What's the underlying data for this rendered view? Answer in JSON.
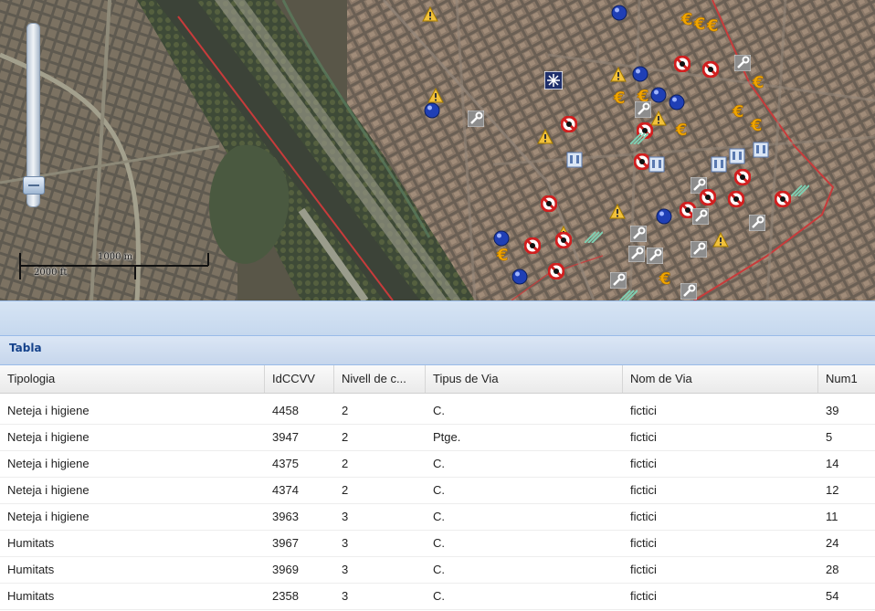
{
  "map": {
    "scale": {
      "metric_label": "1000 m",
      "imperial_label": "2000 ft"
    },
    "icons": {
      "warning": "warning-triangle-icon",
      "euro": "euro-icon",
      "no_entry": "no-entry-icon",
      "wrench": "wrench-icon",
      "blue_dot": "blue-dot-icon",
      "snow": "snowflake-icon",
      "building": "building-icon"
    },
    "colors": {
      "boundary_line": "#c83b3b",
      "warning": "#f2c23b",
      "euro": "#f0a500",
      "no_entry": "#d11f1f",
      "blue_dot": "#1f3fb5"
    }
  },
  "panel": {
    "title": "Tabla"
  },
  "table": {
    "columns": [
      "Tipologia",
      "IdCCVV",
      "Nivell de c...",
      "Tipus de Via",
      "Nom de Via",
      "Num1"
    ],
    "rows": [
      [
        "Neteja i higiene",
        "4458",
        "2",
        "C.",
        "fictici",
        "39"
      ],
      [
        "Neteja i higiene",
        "3947",
        "2",
        "Ptge.",
        "fictici",
        "5"
      ],
      [
        "Neteja i higiene",
        "4375",
        "2",
        "C.",
        "fictici",
        "14"
      ],
      [
        "Neteja i higiene",
        "4374",
        "2",
        "C.",
        "fictici",
        "12"
      ],
      [
        "Neteja i higiene",
        "3963",
        "3",
        "C.",
        "fictici",
        "11"
      ],
      [
        "Humitats",
        "3967",
        "3",
        "C.",
        "fictici",
        "24"
      ],
      [
        "Humitats",
        "3969",
        "3",
        "C.",
        "fictici",
        "28"
      ],
      [
        "Humitats",
        "2358",
        "3",
        "C.",
        "fictici",
        "54"
      ]
    ]
  }
}
